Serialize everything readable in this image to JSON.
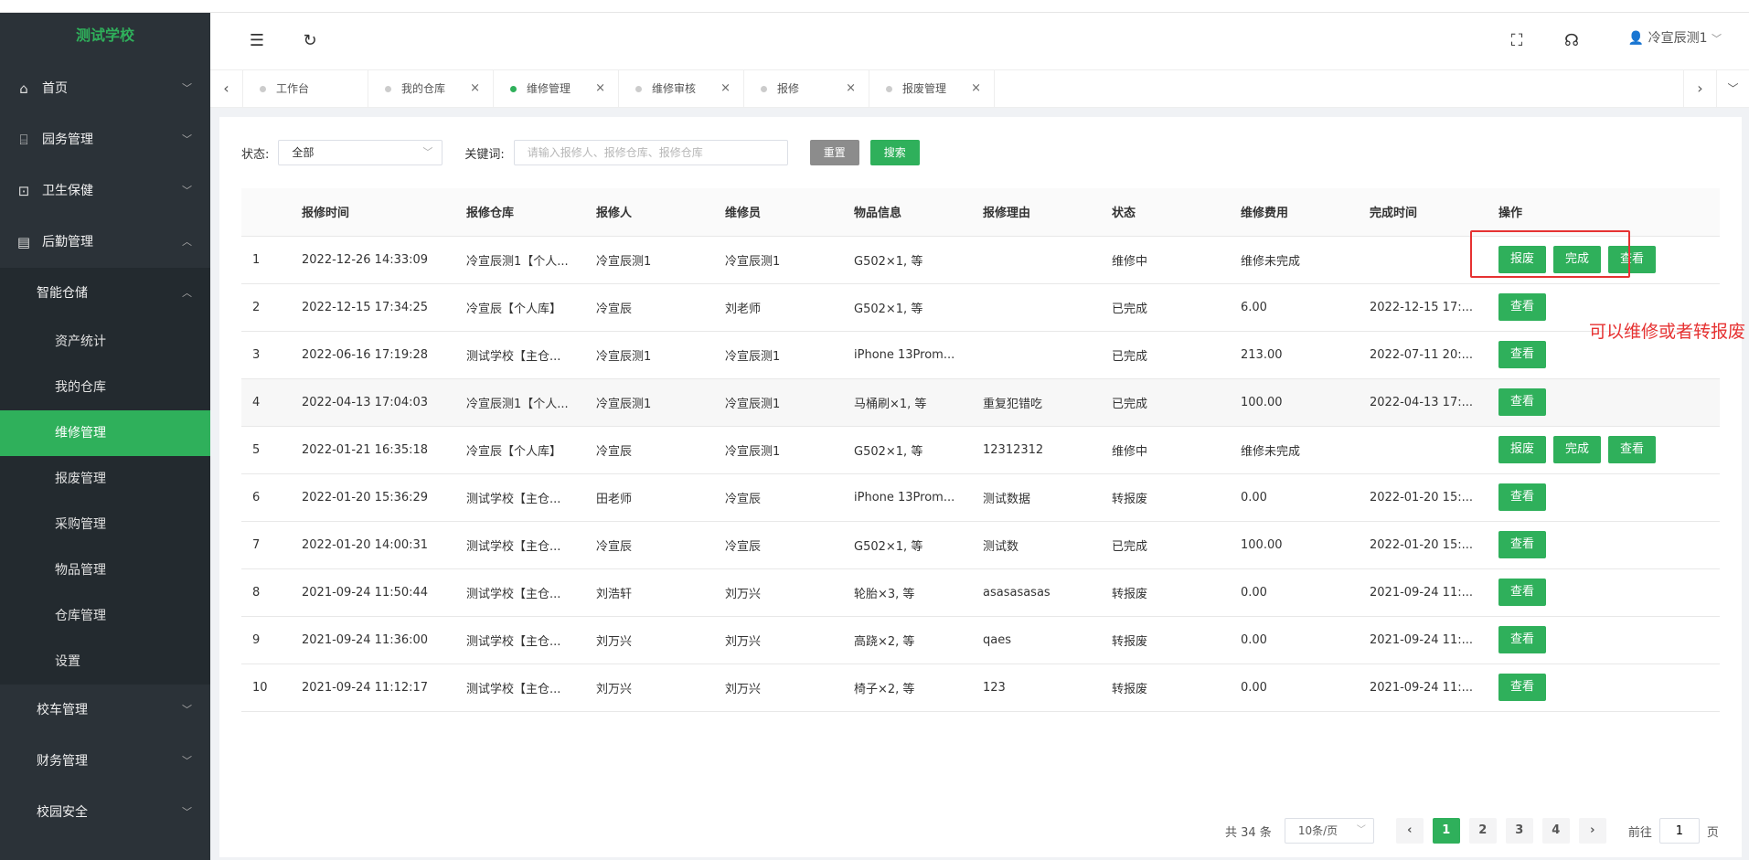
{
  "sidebar": {
    "logo": "测试学校",
    "items": [
      {
        "label": "首页",
        "icon": "home-icon",
        "glyph": "⌂"
      },
      {
        "label": "园务管理",
        "icon": "building-icon",
        "glyph": "⌸"
      },
      {
        "label": "卫生保健",
        "icon": "health-icon",
        "glyph": "⊡"
      },
      {
        "label": "后勤管理",
        "icon": "logistics-icon",
        "glyph": "▤"
      }
    ],
    "group": {
      "label": "智能仓储",
      "items": [
        "资产统计",
        "我的仓库",
        "维修管理",
        "报废管理",
        "采购管理",
        "物品管理",
        "仓库管理",
        "设置"
      ],
      "active_index": 2
    },
    "bottom": [
      "校车管理",
      "财务管理",
      "校园安全"
    ]
  },
  "header": {
    "user": "冷宣辰测1"
  },
  "tabs": [
    {
      "label": "工作台",
      "active": false
    },
    {
      "label": "我的仓库",
      "active": false
    },
    {
      "label": "维修管理",
      "active": true
    },
    {
      "label": "维修审核",
      "active": false
    },
    {
      "label": "报修",
      "active": false
    },
    {
      "label": "报废管理",
      "active": false
    }
  ],
  "filter": {
    "status_label": "状态:",
    "status_value": "全部",
    "keyword_label": "关键词:",
    "keyword_placeholder": "请输入报修人、报修仓库、报修仓库",
    "reset_label": "重置",
    "search_label": "搜索"
  },
  "table": {
    "headers": [
      "",
      "报修时间",
      "报修仓库",
      "报修人",
      "维修员",
      "物品信息",
      "报修理由",
      "状态",
      "维修费用",
      "完成时间",
      "操作"
    ],
    "rows": [
      {
        "idx": "1",
        "time": "2022-12-26 14:33:09",
        "warehouse": "冷宣辰测1【个人...",
        "reporter": "冷宣辰测1",
        "maintainer": "冷宣辰测1",
        "item": "G502×1, 等",
        "reason": "",
        "status": "维修中",
        "fee": "维修未完成",
        "done": "",
        "ops": [
          "报废",
          "完成",
          "查看"
        ]
      },
      {
        "idx": "2",
        "time": "2022-12-15 17:34:25",
        "warehouse": "冷宣辰【个人库】",
        "reporter": "冷宣辰",
        "maintainer": "刘老师",
        "item": "G502×1, 等",
        "reason": "",
        "status": "已完成",
        "fee": "6.00",
        "done": "2022-12-15 17:...",
        "ops": [
          "查看"
        ]
      },
      {
        "idx": "3",
        "time": "2022-06-16 17:19:28",
        "warehouse": "测试学校【主仓...",
        "reporter": "冷宣辰测1",
        "maintainer": "冷宣辰测1",
        "item": "iPhone 13Prom...",
        "reason": "",
        "status": "已完成",
        "fee": "213.00",
        "done": "2022-07-11 20:...",
        "ops": [
          "查看"
        ]
      },
      {
        "idx": "4",
        "time": "2022-04-13 17:04:03",
        "warehouse": "冷宣辰测1【个人...",
        "reporter": "冷宣辰测1",
        "maintainer": "冷宣辰测1",
        "item": "马桶刷×1, 等",
        "reason": "重复犯错吃",
        "status": "已完成",
        "fee": "100.00",
        "done": "2022-04-13 17:...",
        "ops": [
          "查看"
        ]
      },
      {
        "idx": "5",
        "time": "2022-01-21 16:35:18",
        "warehouse": "冷宣辰【个人库】",
        "reporter": "冷宣辰",
        "maintainer": "冷宣辰测1",
        "item": "G502×1, 等",
        "reason": "12312312",
        "status": "维修中",
        "fee": "维修未完成",
        "done": "",
        "ops": [
          "报废",
          "完成",
          "查看"
        ]
      },
      {
        "idx": "6",
        "time": "2022-01-20 15:36:29",
        "warehouse": "测试学校【主仓...",
        "reporter": "田老师",
        "maintainer": "冷宣辰",
        "item": "iPhone 13Prom...",
        "reason": "测试数据",
        "status": "转报废",
        "fee": "0.00",
        "done": "2022-01-20 15:...",
        "ops": [
          "查看"
        ]
      },
      {
        "idx": "7",
        "time": "2022-01-20 14:00:31",
        "warehouse": "测试学校【主仓...",
        "reporter": "冷宣辰",
        "maintainer": "冷宣辰",
        "item": "G502×1, 等",
        "reason": "测试数",
        "status": "已完成",
        "fee": "100.00",
        "done": "2022-01-20 15:...",
        "ops": [
          "查看"
        ]
      },
      {
        "idx": "8",
        "time": "2021-09-24 11:50:44",
        "warehouse": "测试学校【主仓...",
        "reporter": "刘浩轩",
        "maintainer": "刘万兴",
        "item": "轮胎×3, 等",
        "reason": "asasasasas",
        "status": "转报废",
        "fee": "0.00",
        "done": "2021-09-24 11:...",
        "ops": [
          "查看"
        ]
      },
      {
        "idx": "9",
        "time": "2021-09-24 11:36:00",
        "warehouse": "测试学校【主仓...",
        "reporter": "刘万兴",
        "maintainer": "刘万兴",
        "item": "高跷×2, 等",
        "reason": "qaes",
        "status": "转报废",
        "fee": "0.00",
        "done": "2021-09-24 11:...",
        "ops": [
          "查看"
        ]
      },
      {
        "idx": "10",
        "time": "2021-09-24 11:12:17",
        "warehouse": "测试学校【主仓...",
        "reporter": "刘万兴",
        "maintainer": "刘万兴",
        "item": "椅子×2, 等",
        "reason": "123",
        "status": "转报废",
        "fee": "0.00",
        "done": "2021-09-24 11:...",
        "ops": [
          "查看"
        ]
      }
    ]
  },
  "annotation": "可以维修或者转报废",
  "pagination": {
    "total": "共 34 条",
    "page_size": "10条/页",
    "pages": [
      "1",
      "2",
      "3",
      "4"
    ],
    "current": "1",
    "goto_label": "前往",
    "goto_value": "1",
    "page_suffix": "页"
  },
  "colors": {
    "brand": "#2fb05b",
    "sidebar_bg": "#2b3238",
    "annotation": "#e63232"
  }
}
